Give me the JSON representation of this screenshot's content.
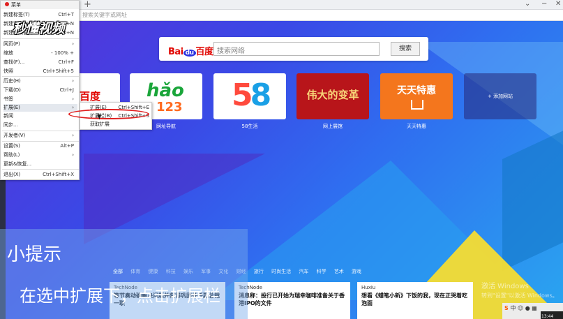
{
  "address_bar": {
    "placeholder": "搜索关键字或网址"
  },
  "search": {
    "logo_bai": "Bai",
    "logo_du": "du",
    "logo_name": "百度",
    "placeholder": "搜索网络",
    "button": "搜索"
  },
  "tiles": [
    {
      "label": "",
      "logo": "百度"
    },
    {
      "label": "网址导航",
      "logo_top": "hǎo",
      "logo_bottom": "123"
    },
    {
      "label": "58生活",
      "logo_a": "5",
      "logo_b": "8"
    },
    {
      "label": "网上展馆",
      "logo": "伟大的变革"
    },
    {
      "label": "天天特惠",
      "logo": "天天特惠"
    },
    {
      "label": "",
      "logo": "+ 添加网站"
    }
  ],
  "categories": [
    "全部",
    "体育",
    "健康",
    "科技",
    "娱乐",
    "军事",
    "文化",
    "财经",
    "旅行",
    "时尚生活",
    "汽车",
    "科学",
    "艺术",
    "游戏"
  ],
  "news": [
    {
      "source": "TechNode",
      "title": "等节奏动确解决问题并获得巩固并任副总裁一职"
    },
    {
      "source": "TechNode",
      "title": "消息称：投行已开始为瑞幸咖啡准备关于香港IPO的文件"
    },
    {
      "source": "Huxiu",
      "title": "想看《蜡笔小新》下饭的我，现在正哭着吃泡面"
    }
  ],
  "activate": {
    "line1": "激活 Windows",
    "line2": "转到\"设置\"以激活 Windows。"
  },
  "taskbar": {
    "ime": "中",
    "time": "13:44"
  },
  "tip": {
    "title": "小提示",
    "text": "在选中扩展下，点击扩展栏"
  },
  "brand": "秒懂视频",
  "menu": {
    "title": "菜单",
    "items": [
      {
        "label": "新建标签(T)",
        "shortcut": "Ctrl+T"
      },
      {
        "label": "新建窗口(N)",
        "shortcut": "Ctrl+N"
      },
      {
        "label": "新建隐私窗口",
        "shortcut": "Ctrl+Shift+N"
      },
      {
        "label": "网页(P)",
        "shortcut": "›"
      },
      {
        "label": "缩放",
        "shortcut": "- 100% +"
      },
      {
        "label": "查找(F)...",
        "shortcut": "Ctrl+F"
      },
      {
        "label": "快照",
        "shortcut": "Ctrl+Shift+5"
      },
      {
        "label": "历史(H)",
        "shortcut": "›"
      },
      {
        "label": "下载(D)",
        "shortcut": "Ctrl+J"
      },
      {
        "label": "书签",
        "shortcut": "›"
      },
      {
        "label": "扩展(E)",
        "shortcut": "›"
      },
      {
        "label": "新闻",
        "shortcut": ""
      },
      {
        "label": "同步...",
        "shortcut": ""
      },
      {
        "label": "开发者(V)",
        "shortcut": "›"
      },
      {
        "label": "设置(S)",
        "shortcut": "Alt+P"
      },
      {
        "label": "帮助(L)",
        "shortcut": "›"
      },
      {
        "label": "更新&恢复...",
        "shortcut": ""
      },
      {
        "label": "退出(X)",
        "shortcut": "Ctrl+Shift+X"
      }
    ]
  },
  "submenu": {
    "items": [
      {
        "label": "扩展(E)",
        "shortcut": "Ctrl+Shift+E"
      },
      {
        "label": "扩展栏(B)",
        "shortcut": "Ctrl+Shift+S"
      },
      {
        "label": "获取扩展",
        "shortcut": ""
      }
    ]
  }
}
